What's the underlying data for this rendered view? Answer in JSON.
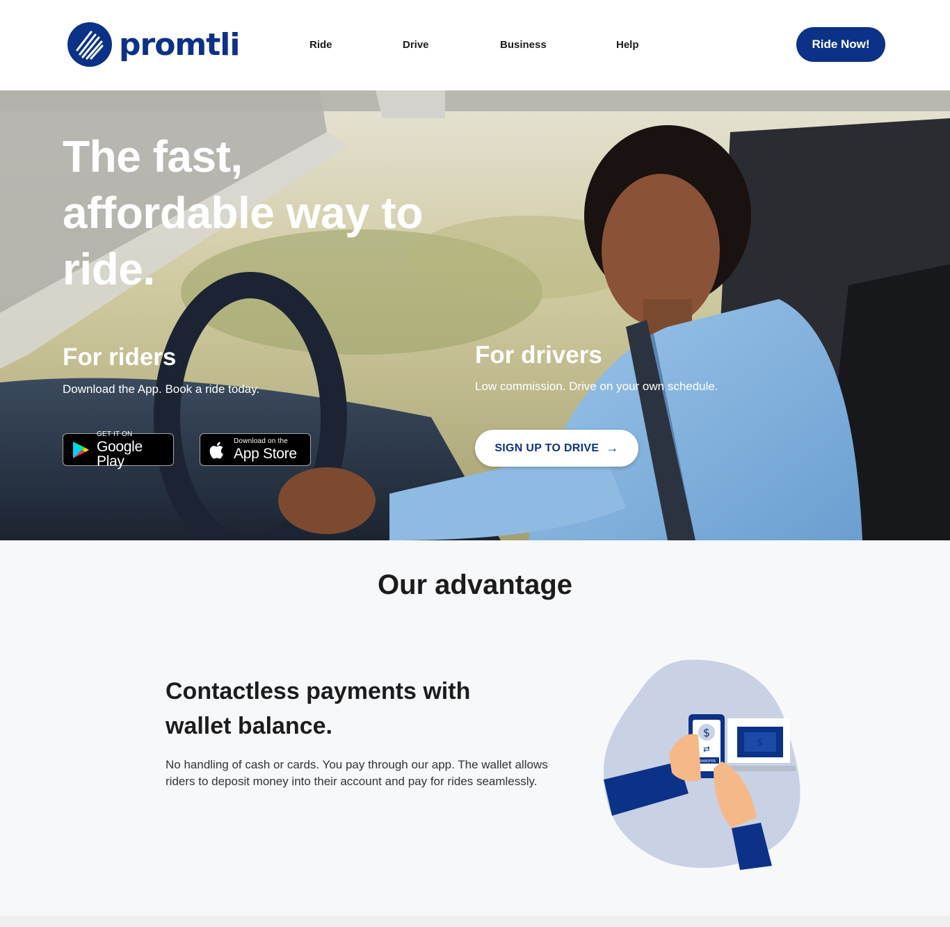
{
  "header": {
    "brand": "promtli",
    "nav": [
      {
        "label": "Ride"
      },
      {
        "label": "Drive"
      },
      {
        "label": "Business"
      },
      {
        "label": "Help"
      }
    ],
    "cta_label": "Ride Now!"
  },
  "hero": {
    "title": "The fast, affordable way to ride.",
    "riders": {
      "title": "For riders",
      "subtitle": "Download the App. Book a ride today.",
      "google_small": "GET IT ON",
      "google_big": "Google Play",
      "apple_small": "Download on the",
      "apple_big": "App Store"
    },
    "drivers": {
      "title": "For drivers",
      "subtitle": "Low commission. Drive on your own schedule.",
      "button_label": "SIGN UP TO DRIVE"
    }
  },
  "advantage": {
    "heading": "Our advantage",
    "title": "Contactless payments with wallet balance.",
    "text": "No handling of cash or cards. You pay through our app. The wallet allows riders to deposit money into their account and pay for rides seamlessly.",
    "illustration_label": "TRANSFER",
    "currency_symbol": "$"
  },
  "colors": {
    "brand": "#0c3288",
    "background_light": "#f7f8fa",
    "illustration_blob": "#c9d1e4",
    "skin": "#f6b887"
  }
}
